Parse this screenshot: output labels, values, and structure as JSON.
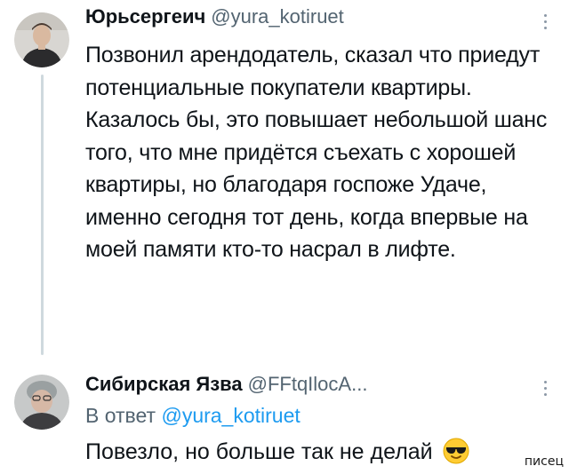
{
  "tweet": {
    "author": {
      "display_name": "Юрьсергеич",
      "handle": "@yura_kotiruet",
      "avatar_icon": "user-photo-avatar"
    },
    "text": "Позвонил арендодатель, сказал что приедут потенциальные покупатели квартиры. Казалось бы, это повышает небольшой шанс того, что мне придётся съехать с хорошей квартиры, но благодаря госпоже Удаче, именно сегодня тот день, когда впервые на моей памяти кто-то насрал в лифте.",
    "more_icon": "more-vertical-icon"
  },
  "reply": {
    "author": {
      "display_name": "Сибирская Язва",
      "handle": "@FFtqIlocA...",
      "avatar_icon": "user-photo-avatar"
    },
    "reply_to_prefix": "В ответ",
    "reply_to_handle": "@yura_kotiruet",
    "text": "Повезло, но больше так не делай",
    "emoji_icon": "sunglasses-emoji-icon",
    "more_icon": "more-vertical-icon"
  },
  "watermark": "писец",
  "colors": {
    "text": "#0f1419",
    "secondary": "#536471",
    "accent": "#1d9bf0",
    "thread_line": "#cfd9de"
  }
}
